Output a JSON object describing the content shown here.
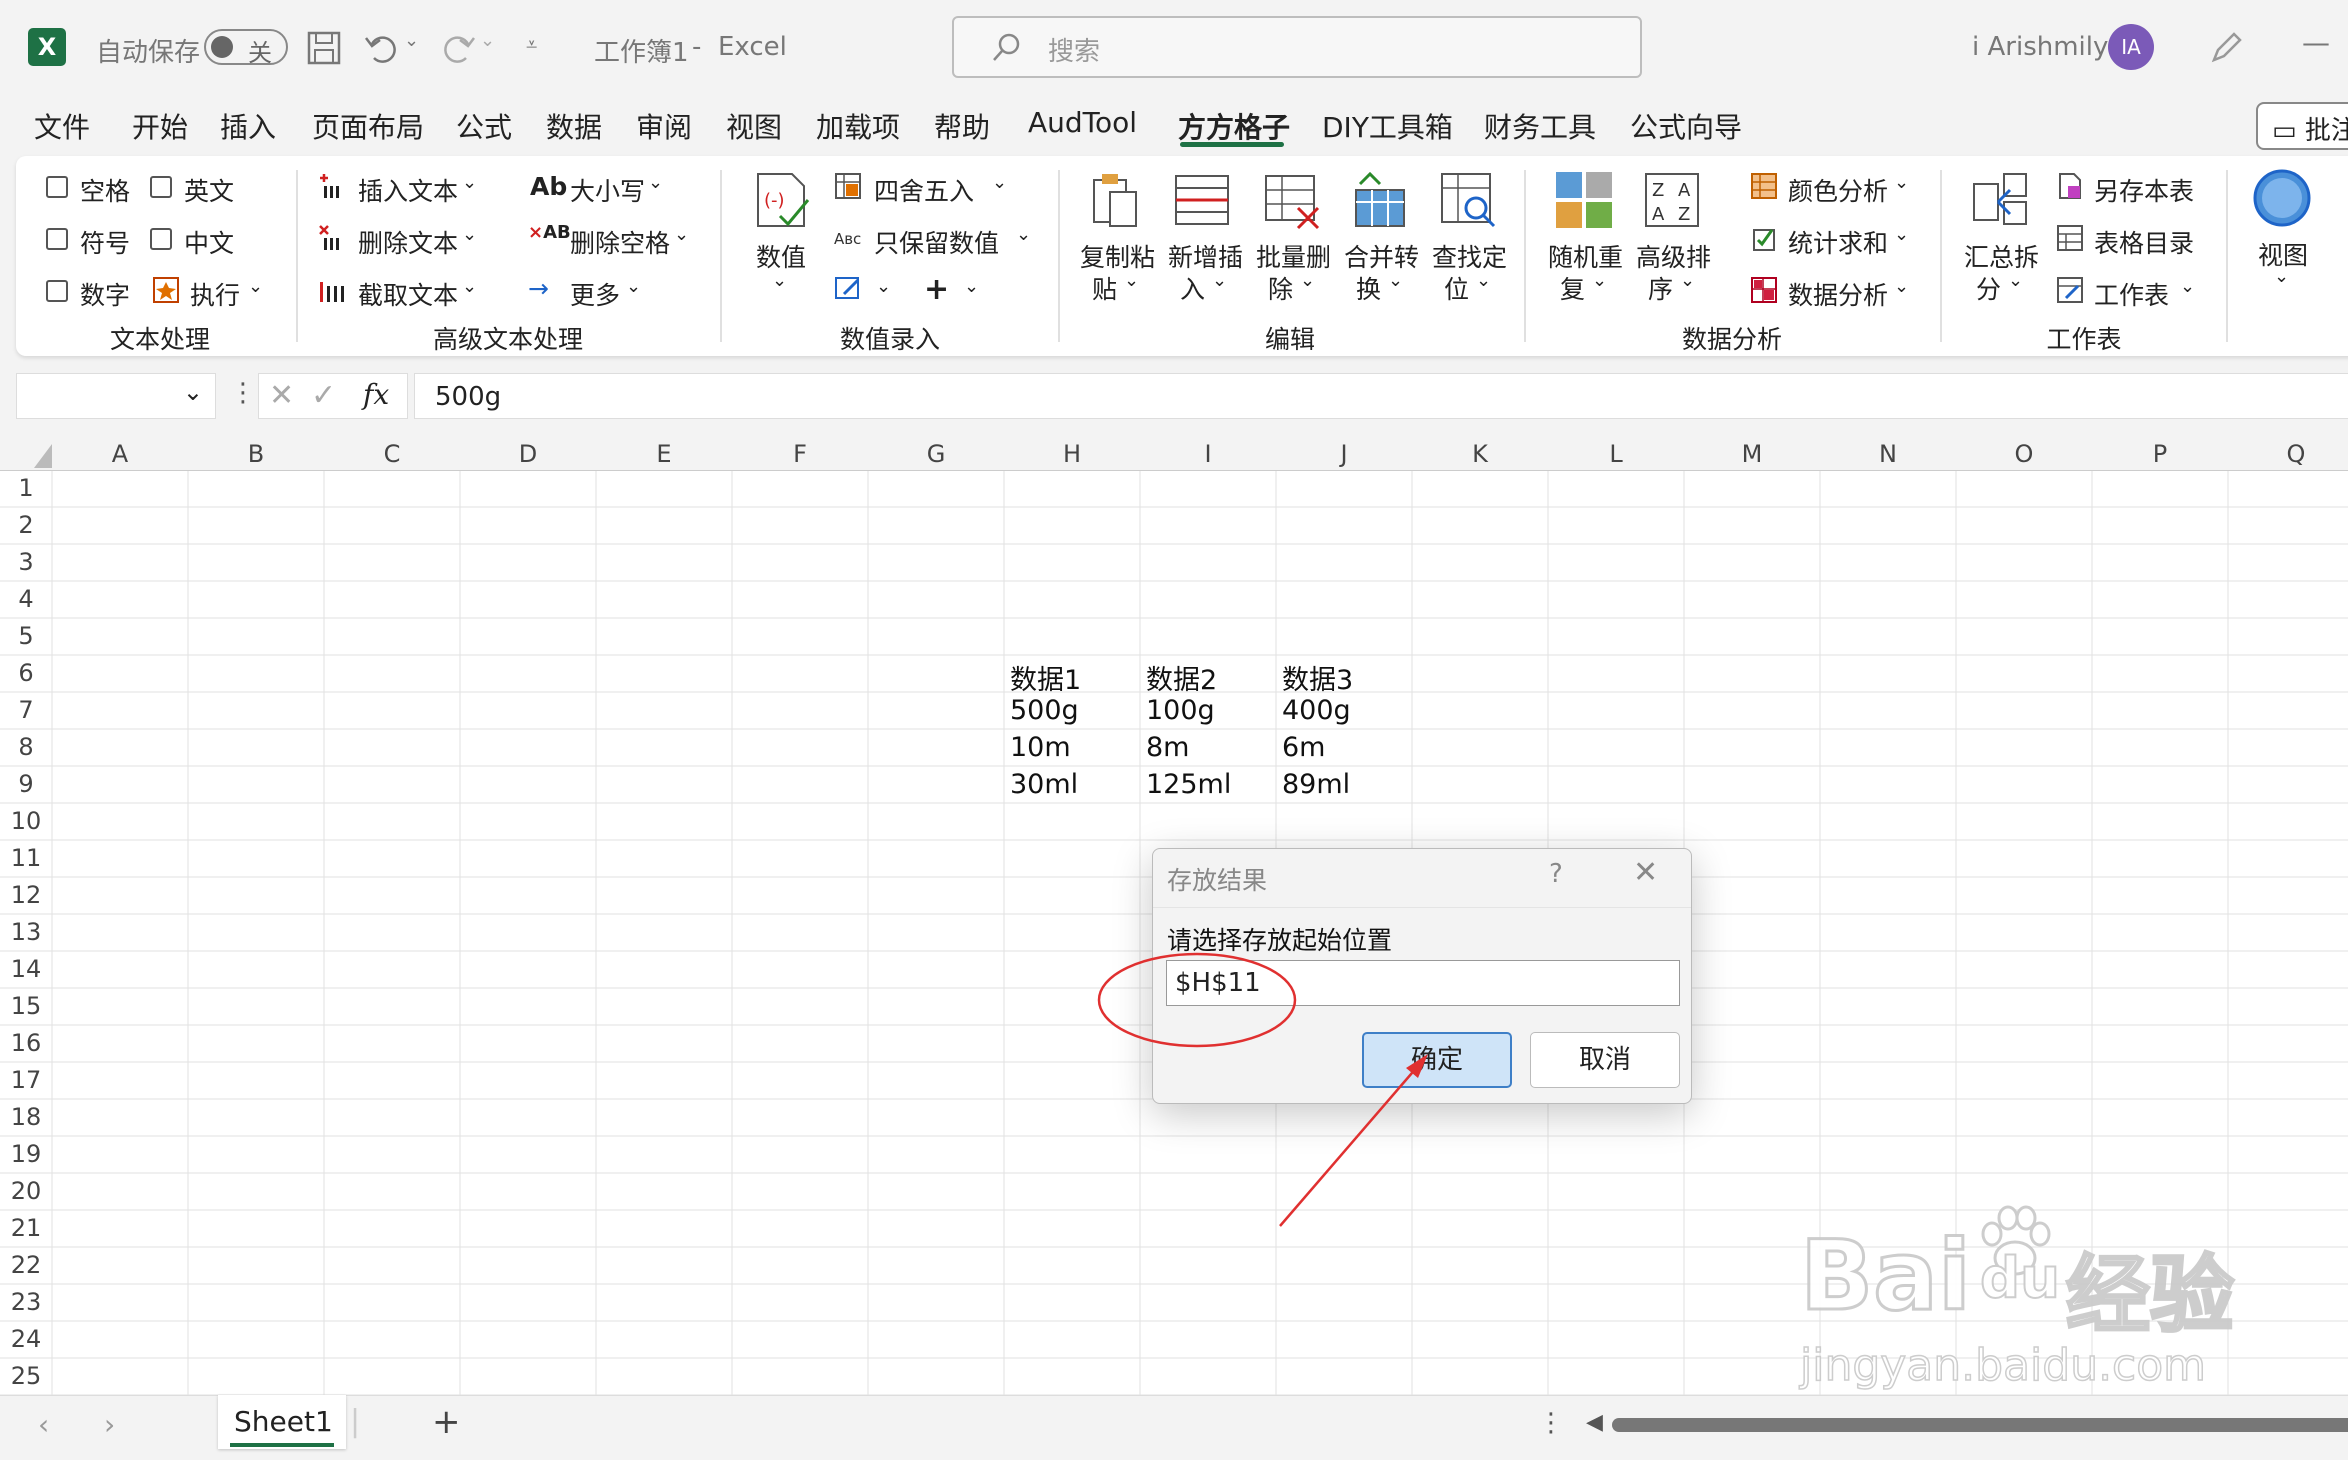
{
  "titlebar": {
    "autosave_label": "自动保存",
    "autosave_state": "关",
    "doc_title": "工作簿1",
    "title_sep": "-",
    "app_name": "Excel",
    "search_placeholder": "搜索",
    "user_name": "i Arishmily",
    "avatar_initials": "IA"
  },
  "menu": {
    "tabs": [
      "文件",
      "开始",
      "插入",
      "页面布局",
      "公式",
      "数据",
      "审阅",
      "视图",
      "加载项",
      "帮助",
      "AudTool",
      "方方格子",
      "DIY工具箱",
      "财务工具",
      "公式向导"
    ],
    "active_tab": "方方格子",
    "comment_label": "批注"
  },
  "ribbon": {
    "text_group": {
      "items": [
        "空格",
        "英文",
        "符号",
        "中文",
        "数字",
        "执行"
      ],
      "label": "文本处理"
    },
    "adv_text_group": {
      "items": [
        "插入文本",
        "删除文本",
        "截取文本",
        "大小写",
        "删除空格",
        "更多"
      ],
      "label": "高级文本处理"
    },
    "num_group": {
      "big": "数值",
      "round": "四舍五入",
      "keep_num": "只保留数值",
      "label": "数值录入"
    },
    "edit_group": {
      "items": [
        {
          "l1": "复制粘",
          "l2": "贴"
        },
        {
          "l1": "新增插",
          "l2": "入"
        },
        {
          "l1": "批量删",
          "l2": "除"
        },
        {
          "l1": "合并转",
          "l2": "换"
        },
        {
          "l1": "查找定",
          "l2": "位"
        }
      ],
      "label": "编辑"
    },
    "analysis_group": {
      "items": [
        {
          "l1": "随机重",
          "l2": "复"
        },
        {
          "l1": "高级排",
          "l2": "序"
        }
      ],
      "color": "颜色分析",
      "sum": "统计求和",
      "data": "数据分析",
      "label": "数据分析"
    },
    "sheet_group": {
      "big": {
        "l1": "汇总拆",
        "l2": "分"
      },
      "save_as": "另存本表",
      "toc": "表格目录",
      "sheet": "工作表",
      "label": "工作表"
    },
    "view_group": {
      "label": "视图"
    }
  },
  "formula_bar": {
    "fx": "fx",
    "value": "500g"
  },
  "grid": {
    "columns": [
      "A",
      "B",
      "C",
      "D",
      "E",
      "F",
      "G",
      "H",
      "I",
      "J",
      "K",
      "L",
      "M",
      "N",
      "O",
      "P",
      "Q"
    ],
    "rows": [
      "1",
      "2",
      "3",
      "4",
      "5",
      "6",
      "7",
      "8",
      "9",
      "10",
      "11",
      "12",
      "13",
      "14",
      "15",
      "16",
      "17",
      "18",
      "19",
      "20",
      "21",
      "22",
      "23",
      "24",
      "25"
    ],
    "cells": {
      "H6": "数据1",
      "I6": "数据2",
      "J6": "数据3",
      "H7": "500g",
      "I7": "100g",
      "J7": "400g",
      "H8": "10m",
      "I8": "8m",
      "J8": "6m",
      "H9": "30ml",
      "I9": "125ml",
      "J9": "89ml"
    }
  },
  "sheets": {
    "tab": "Sheet1",
    "add": "+"
  },
  "dialog": {
    "title": "存放结果",
    "help": "?",
    "prompt": "请选择存放起始位置",
    "value": "$H$11",
    "ok": "确定",
    "cancel": "取消"
  },
  "watermark": {
    "brand": "Bai",
    "brand2": "du",
    "cn": "经验",
    "url": "jingyan.baidu.com"
  },
  "colors": {
    "excel_green": "#1e7145",
    "annotation_red": "#e03030",
    "ok_blue": "#3e7fc7"
  }
}
